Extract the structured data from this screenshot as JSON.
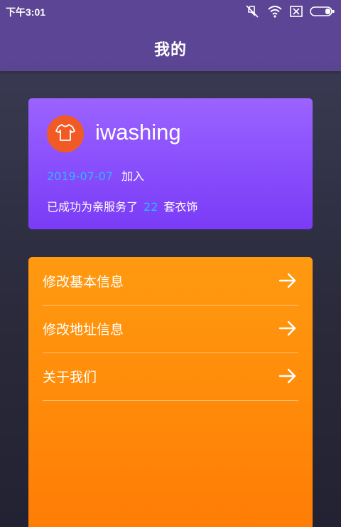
{
  "status_bar": {
    "time": "下午3:01",
    "icons": [
      "mute-icon",
      "wifi-icon",
      "sim-blocked-icon",
      "battery-icon"
    ]
  },
  "header": {
    "title": "我的"
  },
  "profile": {
    "avatar_icon": "tshirt-icon",
    "username": "iwashing",
    "join_date": "2019-07-07",
    "join_suffix": "加入",
    "served_prefix": "已成功为亲服务了",
    "served_count": "22",
    "served_suffix": "套衣饰"
  },
  "menu": {
    "items": [
      {
        "label": "修改基本信息",
        "icon": "arrow-right-icon"
      },
      {
        "label": "修改地址信息",
        "icon": "arrow-right-icon"
      },
      {
        "label": "关于我们",
        "icon": "arrow-right-icon"
      }
    ]
  },
  "colors": {
    "header_bg": "#5b4593",
    "profile_card": "#8a4ffc",
    "menu_card": "#ff8c0a",
    "accent_blue": "#2fb8ff",
    "avatar_bg": "#f15a24"
  }
}
